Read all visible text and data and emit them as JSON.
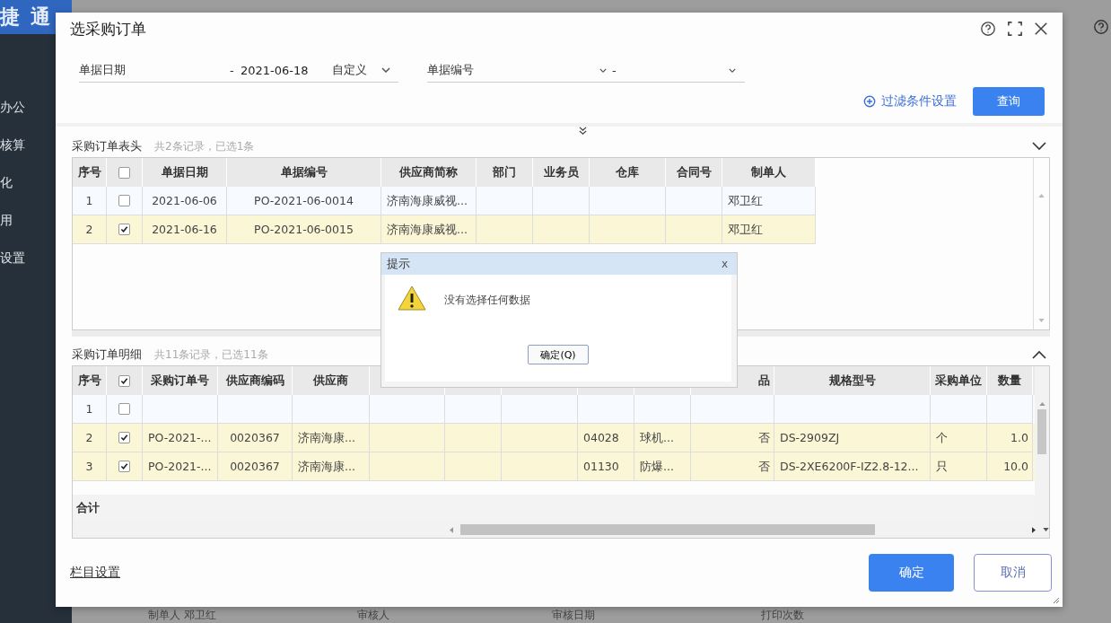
{
  "app": {
    "logo": "捷 通",
    "nav": [
      {
        "label": "办公"
      },
      {
        "label": "核算"
      },
      {
        "label": "化"
      },
      {
        "label": "用"
      },
      {
        "label": "设置"
      }
    ],
    "footer_fields": [
      "制单人 邓卫红",
      "审核人",
      "审核日期",
      "打印次数"
    ]
  },
  "dialog": {
    "title": "选采购订单",
    "filters": [
      {
        "kind": "date_range",
        "label": "单据日期",
        "separator": "-",
        "value": "2021-06-18",
        "mode": "自定义"
      },
      {
        "kind": "select_range",
        "label": "单据编号",
        "separator": "-"
      }
    ],
    "filter_settings": "过滤条件设置",
    "query_button": "查询",
    "header_section": {
      "title": "采购订单表头",
      "summary": "共2条记录，已选1条",
      "all_checked": false,
      "columns": [
        "序号",
        null,
        "单据日期",
        "单据编号",
        "供应商简称",
        "部门",
        "业务员",
        "仓库",
        "合同号",
        "制单人"
      ],
      "rows": [
        {
          "checked": false,
          "selected": false,
          "cells": [
            "1",
            null,
            "2021-06-06",
            "PO-2021-06-0014",
            "济南海康威视...",
            null,
            null,
            null,
            null,
            "邓卫红"
          ]
        },
        {
          "checked": true,
          "selected": true,
          "cells": [
            "2",
            null,
            "2021-06-16",
            "PO-2021-06-0015",
            "济南海康威视...",
            null,
            null,
            null,
            null,
            "邓卫红"
          ]
        }
      ]
    },
    "detail_section": {
      "title": "采购订单明细",
      "summary": "共11条记录，已选11条",
      "all_checked": true,
      "columns": [
        "序号",
        null,
        "采购订单号",
        "供应商编码",
        "供应商",
        null,
        null,
        null,
        null,
        null,
        "品",
        "规格型号",
        "采购单位",
        "数量"
      ],
      "rows": [
        {
          "checked": false,
          "selected": false,
          "cells": [
            "1",
            null,
            null,
            null,
            null,
            null,
            null,
            null,
            null,
            null,
            null,
            null,
            null,
            null
          ]
        },
        {
          "checked": true,
          "selected": true,
          "cells": [
            "2",
            null,
            "PO-2021-...",
            "0020367",
            "济南海康...",
            null,
            null,
            null,
            "04028",
            "球机...",
            "否",
            "DS-2909ZJ",
            "个",
            "1.0"
          ]
        },
        {
          "checked": true,
          "selected": true,
          "cells": [
            "3",
            null,
            "PO-2021-...",
            "0020367",
            "济南海康...",
            null,
            null,
            null,
            "01130",
            "防爆...",
            "否",
            "DS-2XE6200F-IZ2.8-12...",
            "只",
            "10.0"
          ]
        }
      ],
      "total_label": "合计"
    },
    "column_settings": "栏目设置",
    "ok_button": "确定",
    "cancel_button": "取消"
  },
  "alert": {
    "title": "提示",
    "close": "x",
    "message": "没有选择任何数据",
    "button": "确定(Q)"
  }
}
